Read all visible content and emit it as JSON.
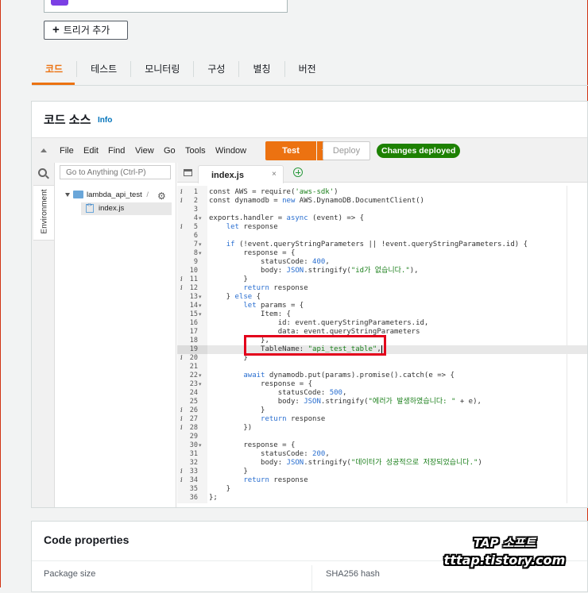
{
  "triggers": {
    "add_button_label": "트리거 추가",
    "plus_glyph": "+"
  },
  "tabs": [
    {
      "label": "코드",
      "active": true
    },
    {
      "label": "테스트"
    },
    {
      "label": "모니터링"
    },
    {
      "label": "구성"
    },
    {
      "label": "별칭"
    },
    {
      "label": "버전"
    }
  ],
  "code_source": {
    "title": "코드 소스",
    "info_link": "Info",
    "menu": [
      "File",
      "Edit",
      "Find",
      "View",
      "Go",
      "Tools",
      "Window"
    ],
    "test_button": "Test",
    "deploy_button": "Deploy",
    "status_badge": "Changes deployed",
    "side_tab_label": "Environment",
    "goto_placeholder": "Go to Anything (Ctrl-P)",
    "tree": {
      "folder": "lambda_api_test",
      "folder_suffix": "/",
      "file": "index.js"
    },
    "editor": {
      "open_tab": "index.js",
      "close_glyph": "×",
      "cursor_line": 19,
      "info_lines": [
        1,
        2,
        5,
        11,
        12,
        20,
        26,
        27,
        28,
        33,
        34
      ],
      "fold_lines": [
        4,
        7,
        8,
        13,
        14,
        15,
        22,
        23,
        30
      ],
      "lines": [
        [
          [
            "const AWS = require(",
            ""
          ],
          [
            "'aws-sdk'",
            "str"
          ],
          [
            ")",
            ""
          ]
        ],
        [
          [
            "const dynamodb = ",
            ""
          ],
          [
            "new",
            "kw"
          ],
          [
            " AWS.DynamoDB.DocumentClient()",
            ""
          ]
        ],
        [],
        [
          [
            "exports.handler = ",
            ""
          ],
          [
            "async",
            "kw"
          ],
          [
            " (event) => {",
            ""
          ]
        ],
        [
          [
            "    ",
            ""
          ],
          [
            "let",
            "kw"
          ],
          [
            " response",
            ""
          ]
        ],
        [],
        [
          [
            "    ",
            ""
          ],
          [
            "if",
            "kw"
          ],
          [
            " (!event.queryStringParameters || !event.queryStringParameters.id) {",
            ""
          ]
        ],
        [
          [
            "        response = {",
            ""
          ]
        ],
        [
          [
            "            statusCode: ",
            ""
          ],
          [
            "400",
            "kw"
          ],
          [
            ",",
            ""
          ]
        ],
        [
          [
            "            body: ",
            ""
          ],
          [
            "JSON",
            "obj"
          ],
          [
            ".stringify(",
            ""
          ],
          [
            "\"id가 없습니다.\"",
            "str"
          ],
          [
            "),",
            ""
          ]
        ],
        [
          [
            "        }",
            ""
          ]
        ],
        [
          [
            "        ",
            ""
          ],
          [
            "return",
            "kw"
          ],
          [
            " response",
            ""
          ]
        ],
        [
          [
            "    } ",
            ""
          ],
          [
            "else",
            "kw"
          ],
          [
            " {",
            ""
          ]
        ],
        [
          [
            "        ",
            ""
          ],
          [
            "let",
            "kw"
          ],
          [
            " params = {",
            ""
          ]
        ],
        [
          [
            "            Item: {",
            ""
          ]
        ],
        [
          [
            "                id: event.queryStringParameters.id,",
            ""
          ]
        ],
        [
          [
            "                data: event.queryStringParameters",
            ""
          ]
        ],
        [
          [
            "            },",
            ""
          ]
        ],
        [
          [
            "            TableName: ",
            ""
          ],
          [
            "\"api_test_table\"",
            "str"
          ],
          [
            ",",
            ""
          ]
        ],
        [
          [
            "        }",
            ""
          ]
        ],
        [],
        [
          [
            "        ",
            ""
          ],
          [
            "await",
            "kw"
          ],
          [
            " dynamodb.put(params).promise().catch(e => {",
            ""
          ]
        ],
        [
          [
            "            response = {",
            ""
          ]
        ],
        [
          [
            "                statusCode: ",
            ""
          ],
          [
            "500",
            "kw"
          ],
          [
            ",",
            ""
          ]
        ],
        [
          [
            "                body: ",
            ""
          ],
          [
            "JSON",
            "obj"
          ],
          [
            ".stringify(",
            ""
          ],
          [
            "\"에러가 발생하였습니다: \"",
            "str"
          ],
          [
            " + e),",
            ""
          ]
        ],
        [
          [
            "            }",
            ""
          ]
        ],
        [
          [
            "            ",
            ""
          ],
          [
            "return",
            "kw"
          ],
          [
            " response",
            ""
          ]
        ],
        [
          [
            "        })",
            ""
          ]
        ],
        [],
        [
          [
            "        response = {",
            ""
          ]
        ],
        [
          [
            "            statusCode: ",
            ""
          ],
          [
            "200",
            "kw"
          ],
          [
            ",",
            ""
          ]
        ],
        [
          [
            "            body: ",
            ""
          ],
          [
            "JSON",
            "obj"
          ],
          [
            ".stringify(",
            ""
          ],
          [
            "\"데이터가 성공적으로 저장되었습니다.\"",
            "str"
          ],
          [
            ")",
            ""
          ]
        ],
        [
          [
            "        }",
            ""
          ]
        ],
        [
          [
            "        ",
            ""
          ],
          [
            "return",
            "kw"
          ],
          [
            " response",
            ""
          ]
        ],
        [
          [
            "    }",
            ""
          ]
        ],
        [
          [
            "};",
            ""
          ]
        ]
      ]
    }
  },
  "code_properties": {
    "title": "Code properties",
    "package_size_label": "Package size",
    "sha_label": "SHA256 hash"
  },
  "watermark": {
    "line1": "TAP 소프트",
    "line2": "tttap.tistory.com"
  },
  "colors": {
    "accent": "#ec7211",
    "success": "#1d8102",
    "link": "#0073bb",
    "highlight": "#e3001b"
  }
}
